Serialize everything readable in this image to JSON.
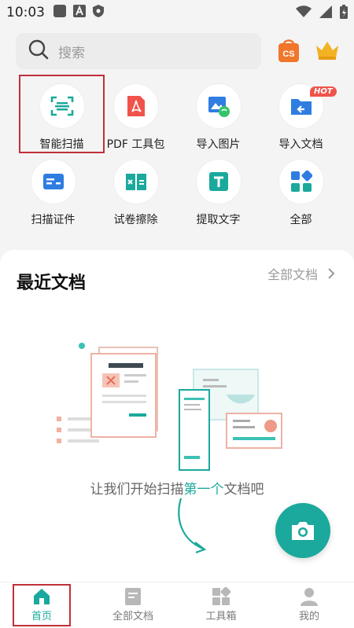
{
  "status_bar": {
    "time": "10:03"
  },
  "search": {
    "placeholder": "搜索"
  },
  "tools": [
    {
      "label": "智能扫描",
      "icon": "scan-icon"
    },
    {
      "label": "PDF 工具包",
      "icon": "pdf-icon"
    },
    {
      "label": "导入图片",
      "icon": "import-image-icon"
    },
    {
      "label": "导入文档",
      "icon": "import-document-icon",
      "badge": "HOT"
    },
    {
      "label": "扫描证件",
      "icon": "id-card-icon"
    },
    {
      "label": "试卷擦除",
      "icon": "erase-paper-icon"
    },
    {
      "label": "提取文字",
      "icon": "extract-text-icon"
    },
    {
      "label": "全部",
      "icon": "all-apps-icon"
    }
  ],
  "recent": {
    "title": "最近文档",
    "all_link": "全部文档",
    "empty_prefix": "让我们开始扫描",
    "empty_highlight": "第一个",
    "empty_suffix": "文档吧"
  },
  "bottom_nav": [
    {
      "label": "首页",
      "icon": "home-icon",
      "active": true
    },
    {
      "label": "全部文档",
      "icon": "document-icon"
    },
    {
      "label": "工具箱",
      "icon": "toolbox-icon"
    },
    {
      "label": "我的",
      "icon": "profile-icon"
    }
  ],
  "colors": {
    "accent": "#1aa99c",
    "pdf_red": "#f0534a",
    "blue": "#2f7de1",
    "hot": "#f0534a"
  }
}
